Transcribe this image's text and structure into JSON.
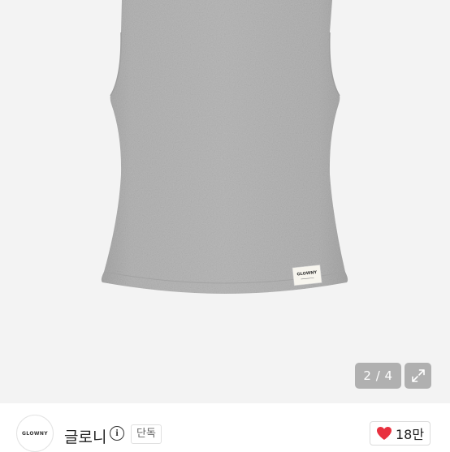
{
  "product_image": {
    "alt": "",
    "label_text": "GLOWNY"
  },
  "carousel": {
    "indicator": "2 / 4",
    "current": 2,
    "total": 4
  },
  "expand": {
    "icon": "expand-arrows-icon"
  },
  "brand": {
    "logo_text": "GLOWNY",
    "name": "글로니",
    "info_icon": "info-icon",
    "badge": "단독"
  },
  "like": {
    "icon": "heart-icon",
    "count": "18만",
    "color": "#e8313f"
  },
  "colors": {
    "image_background": "#f3f3f3",
    "garment": "#b4b4b4"
  }
}
